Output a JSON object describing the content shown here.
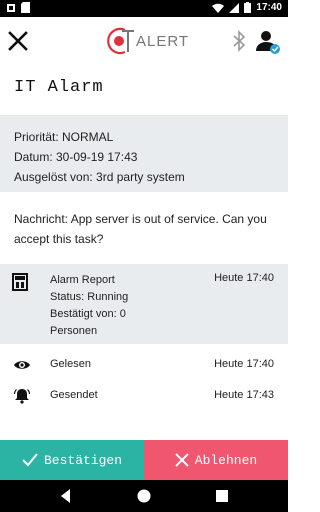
{
  "status_bar": {
    "time": "17:40"
  },
  "app": {
    "logo_text": "ALERT"
  },
  "alarm": {
    "title": "IT Alarm",
    "priority": "Priorität: NORMAL",
    "date": "Datum: 30-09-19 17:43",
    "triggered_by": "Ausgelöst von: 3rd party system",
    "message": "Nachricht: App server is out of service. Can you accept this task?"
  },
  "report": {
    "title": "Alarm Report",
    "status": "Status: Running",
    "confirmed_by": "Bestätigt von: 0",
    "persons": "Personen",
    "time": "Heute 17:40"
  },
  "events": [
    {
      "label": "Gelesen",
      "time": "Heute 17:40",
      "icon": "eye-icon"
    },
    {
      "label": "Gesendet",
      "time": "Heute 17:43",
      "icon": "bell-icon"
    }
  ],
  "actions": {
    "confirm": "Bestätigen",
    "reject": "Ablehnen"
  },
  "colors": {
    "confirm": "#2bb3a4",
    "reject": "#f0566e",
    "panel": "#e9ecef",
    "logo_red": "#e0303c"
  }
}
